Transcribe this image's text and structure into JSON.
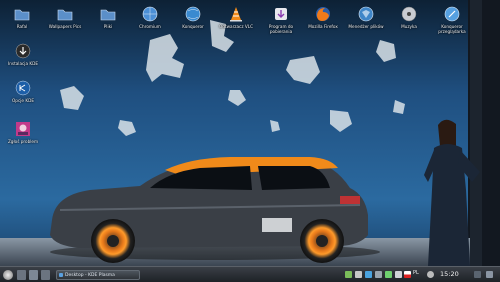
{
  "desktop": {
    "top_icons": [
      {
        "label": "Rafal",
        "icon": "folder-icon"
      },
      {
        "label": "Wallpapers Pics",
        "icon": "folder-icon"
      },
      {
        "label": "Pliki",
        "icon": "folder-icon"
      },
      {
        "label": "Chromium",
        "icon": "globe-icon"
      },
      {
        "label": "Konqueror",
        "icon": "globe-icon"
      },
      {
        "label": "Odtwarzacz VLC",
        "icon": "vlc-cone-icon"
      },
      {
        "label": "Program do pobierania",
        "icon": "downloader-icon"
      },
      {
        "label": "Mozilla Firefox",
        "icon": "firefox-icon"
      },
      {
        "label": "Menedżer plików",
        "icon": "globe-icon"
      },
      {
        "label": "Muzyka",
        "icon": "disc-icon"
      },
      {
        "label": "Konqueror przeglądarka",
        "icon": "globe-icon"
      }
    ],
    "left_icons": [
      {
        "label": "Instalacja KDE",
        "icon": "install-icon"
      },
      {
        "label": "Opcje KDE",
        "icon": "kde-icon"
      },
      {
        "label": "Zgłoś problem",
        "icon": "report-icon"
      }
    ]
  },
  "taskbar": {
    "task_label": "Desktop - KDE Plasma",
    "language": "PL",
    "clock": "15:20"
  },
  "colors": {
    "accent": "#f08a1a",
    "taskbar": "#2a2f35",
    "wall_blue": "#2c5d8f"
  }
}
